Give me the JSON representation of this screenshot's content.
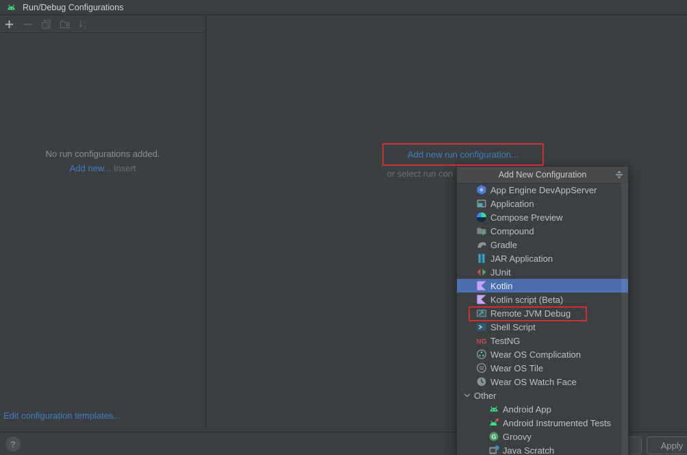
{
  "window": {
    "title": "Run/Debug Configurations"
  },
  "left_panel": {
    "toolbar": [
      {
        "name": "add",
        "enabled": true
      },
      {
        "name": "remove",
        "enabled": false
      },
      {
        "name": "copy",
        "enabled": false
      },
      {
        "name": "new-folder",
        "enabled": false
      },
      {
        "name": "sort-alphabetically",
        "enabled": false
      }
    ],
    "empty_message": "No run configurations added.",
    "add_new_label": "Add new...",
    "add_new_shortcut": "Insert",
    "edit_templates_label": "Edit configuration templates..."
  },
  "main_area": {
    "add_new_link": "Add new run configuration...",
    "select_hint_visible": "or select run con"
  },
  "popup": {
    "title": "Add New Configuration",
    "items": [
      {
        "label": "App Engine DevAppServer",
        "icon": "app-engine"
      },
      {
        "label": "Application",
        "icon": "application"
      },
      {
        "label": "Compose Preview",
        "icon": "compose-preview"
      },
      {
        "label": "Compound",
        "icon": "compound"
      },
      {
        "label": "Gradle",
        "icon": "gradle"
      },
      {
        "label": "JAR Application",
        "icon": "jar-application"
      },
      {
        "label": "JUnit",
        "icon": "junit"
      },
      {
        "label": "Kotlin",
        "icon": "kotlin",
        "selected": true
      },
      {
        "label": "Kotlin script (Beta)",
        "icon": "kotlin"
      },
      {
        "label": "Remote JVM Debug",
        "icon": "remote-jvm-debug",
        "red_outlined": true
      },
      {
        "label": "Shell Script",
        "icon": "shell-script"
      },
      {
        "label": "TestNG",
        "icon": "testng"
      },
      {
        "label": "Wear OS Complication",
        "icon": "wear-os-complication"
      },
      {
        "label": "Wear OS Tile",
        "icon": "wear-os-tile"
      },
      {
        "label": "Wear OS Watch Face",
        "icon": "wear-os-watch-face"
      },
      {
        "label": "Other",
        "group": true,
        "expanded": true
      },
      {
        "label": "Android App",
        "icon": "android-app",
        "indent": 1
      },
      {
        "label": "Android Instrumented Tests",
        "icon": "android-instrumented-tests",
        "indent": 1
      },
      {
        "label": "Groovy",
        "icon": "groovy",
        "indent": 1
      },
      {
        "label": "Java Scratch",
        "icon": "java-scratch",
        "indent": 1
      }
    ]
  },
  "footer": {
    "help_label": "?",
    "apply_label": "Apply"
  },
  "colors": {
    "background": "#3c3f41",
    "selection_blue": "#4b6eaf",
    "link_blue": "#3e7cbf",
    "annotation_red": "#cf2f2f",
    "android_green": "#3ddc84"
  }
}
